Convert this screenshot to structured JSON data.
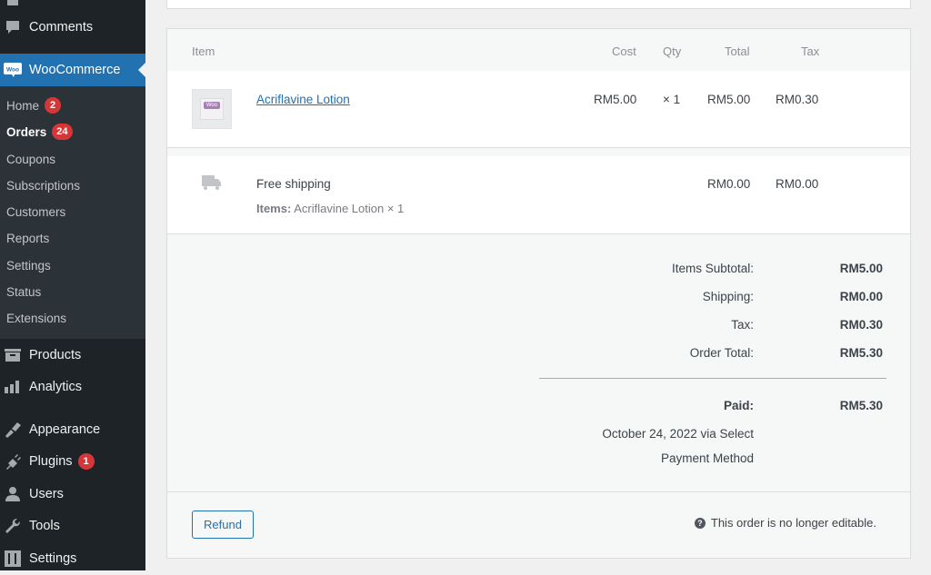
{
  "sidebar": {
    "top_items": [
      {
        "label": "Comments",
        "icon": "comment-icon"
      },
      {
        "label": "WooCommerce",
        "icon": "woocommerce-icon",
        "active": true
      }
    ],
    "woo_submenu": [
      {
        "label": "Home",
        "badge": "2"
      },
      {
        "label": "Orders",
        "badge": "24",
        "current": true
      },
      {
        "label": "Coupons"
      },
      {
        "label": "Subscriptions"
      },
      {
        "label": "Customers"
      },
      {
        "label": "Reports"
      },
      {
        "label": "Settings"
      },
      {
        "label": "Status"
      },
      {
        "label": "Extensions"
      }
    ],
    "bottom_items": [
      {
        "label": "Products",
        "icon": "archive-icon"
      },
      {
        "label": "Analytics",
        "icon": "bar-chart-icon"
      },
      {
        "label": "Appearance",
        "icon": "paintbrush-icon"
      },
      {
        "label": "Plugins",
        "icon": "plugin-icon",
        "badge": "1"
      },
      {
        "label": "Users",
        "icon": "user-icon"
      },
      {
        "label": "Tools",
        "icon": "wrench-icon"
      },
      {
        "label": "Settings",
        "icon": "settings-icon"
      }
    ],
    "woo_logo_text": "Woo"
  },
  "order_items": {
    "headers": {
      "item": "Item",
      "cost": "Cost",
      "qty": "Qty",
      "total": "Total",
      "tax": "Tax"
    },
    "line_items": [
      {
        "name": "Acriflavine Lotion",
        "cost": "RM5.00",
        "qty": "× 1",
        "total": "RM5.00",
        "tax": "RM0.30"
      }
    ],
    "shipping": {
      "method": "Free shipping",
      "items_label": "Items:",
      "items_value": "Acriflavine Lotion × 1",
      "total": "RM0.00",
      "tax": "RM0.00"
    },
    "totals": [
      {
        "label": "Items Subtotal:",
        "value": "RM5.00"
      },
      {
        "label": "Shipping:",
        "value": "RM0.00"
      },
      {
        "label": "Tax:",
        "value": "RM0.30"
      },
      {
        "label": "Order Total:",
        "value": "RM5.30"
      }
    ],
    "paid": {
      "label": "Paid:",
      "value": "RM5.30",
      "date_line1": "October 24, 2022 via Select",
      "date_line2": "Payment Method"
    },
    "refund_button": "Refund",
    "not_editable_notice": "This order is no longer editable."
  },
  "colors": {
    "sidebar_bg": "#1d2327",
    "submenu_bg": "#2c3338",
    "accent": "#2271b1",
    "badge": "#d63638"
  }
}
